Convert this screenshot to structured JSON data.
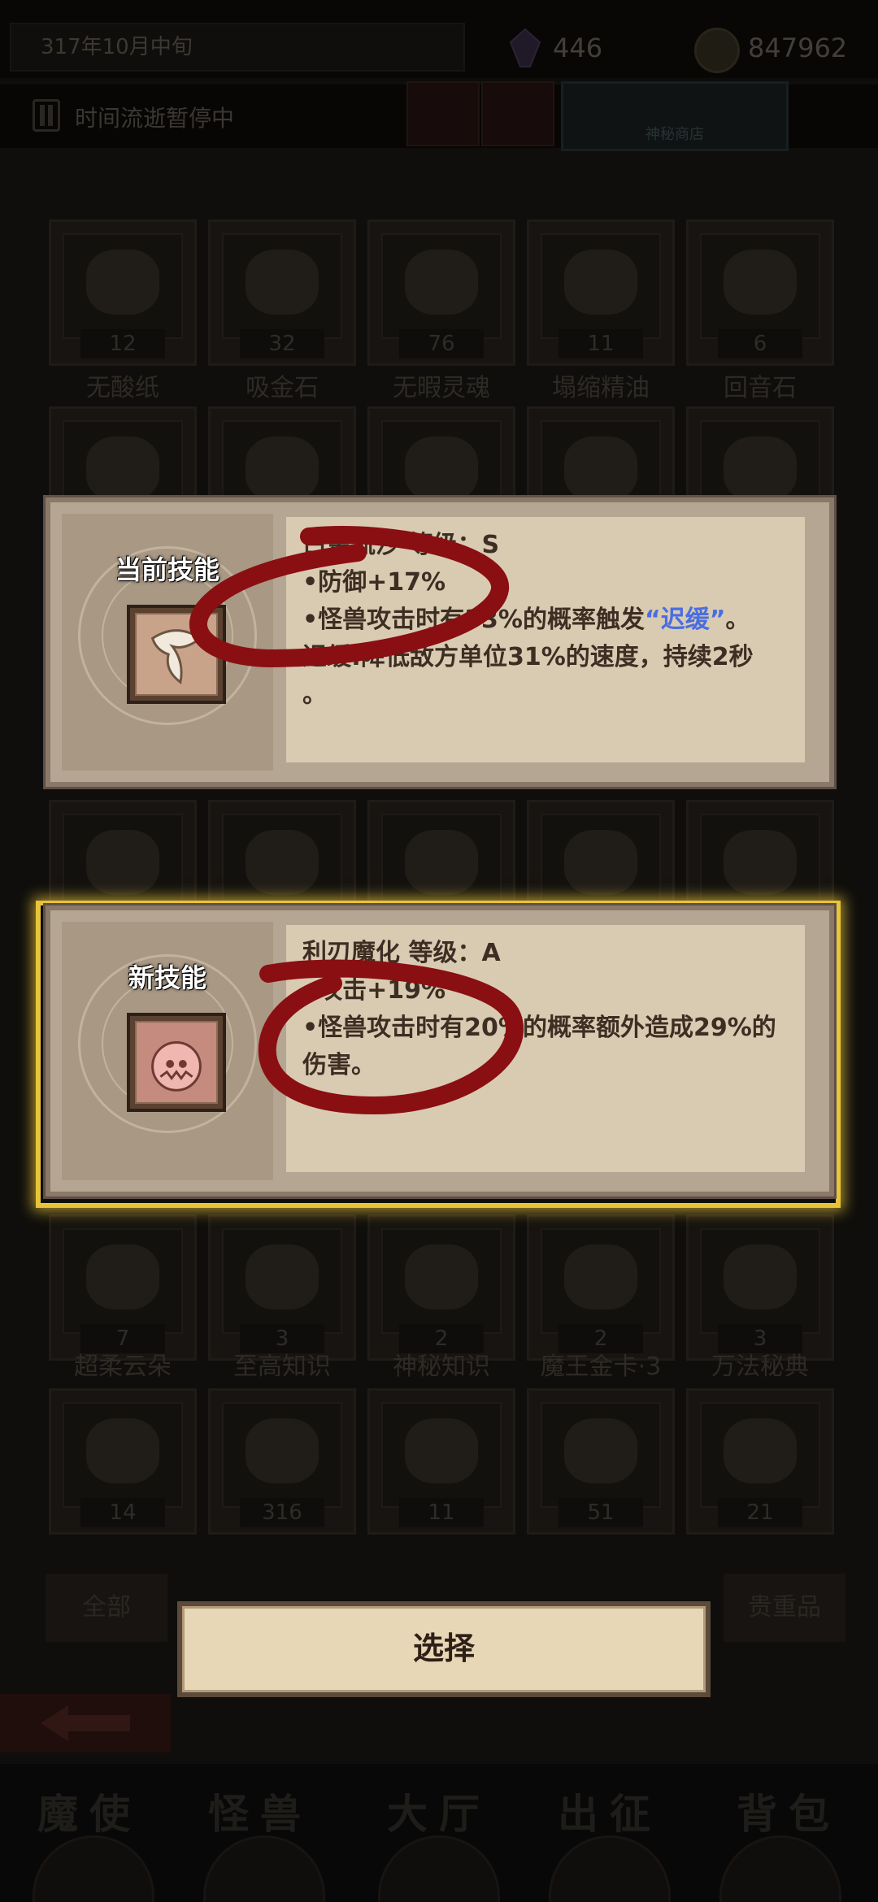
{
  "status": {
    "date": "317年10月中旬",
    "gems": "446",
    "gold": "847962"
  },
  "time_bar": {
    "label": "时间流逝暂停中",
    "tab1": "",
    "tab2": "",
    "shop_label": "神秘商店"
  },
  "inventory": {
    "row1": [
      {
        "name": "无酸纸",
        "count": "12"
      },
      {
        "name": "吸金石",
        "count": "32"
      },
      {
        "name": "无暇灵魂",
        "count": "76"
      },
      {
        "name": "塌缩精油",
        "count": "11"
      },
      {
        "name": "回音石",
        "count": "6"
      }
    ],
    "row5": [
      {
        "name": "超柔云朵",
        "count": "7"
      },
      {
        "name": "至高知识",
        "count": "3"
      },
      {
        "name": "神秘知识",
        "count": "2"
      },
      {
        "name": "魔王金卡·3",
        "count": "2"
      },
      {
        "name": "万法秘典",
        "count": "3"
      }
    ],
    "row6": [
      {
        "count": "14"
      },
      {
        "count": "316"
      },
      {
        "count": "11"
      },
      {
        "count": "51"
      },
      {
        "count": "21"
      }
    ]
  },
  "current_skill": {
    "heading": "当前技能",
    "title": "白金流沙 等级：S",
    "line1": "•防御+17%",
    "line2_prefix": "•怪兽攻击时有33%的概率触发",
    "line2_highlight": "“迟缓”",
    "line2_suffix": "。",
    "line3": "迟缓:降低敌方单位31%的速度，持续2秒",
    "line4": "。"
  },
  "new_skill": {
    "heading": "新技能",
    "title": "利刃魔化 等级：A",
    "line1": "•攻击+19%",
    "line2": "•怪兽攻击时有20%的概率额外造成29%的",
    "line3": "伤害。"
  },
  "actions": {
    "select": "选择",
    "filter_all": "全部",
    "filter_valuable": "贵重品"
  },
  "bottom_nav": {
    "item1": "魔使",
    "item2": "怪兽",
    "item3": "大厅",
    "item4": "出征",
    "item5": "背包"
  },
  "colors": {
    "highlight_frame": "#e8c43a",
    "keyword_blue": "#4a6ee0",
    "annotation_red": "#8a0f12"
  }
}
